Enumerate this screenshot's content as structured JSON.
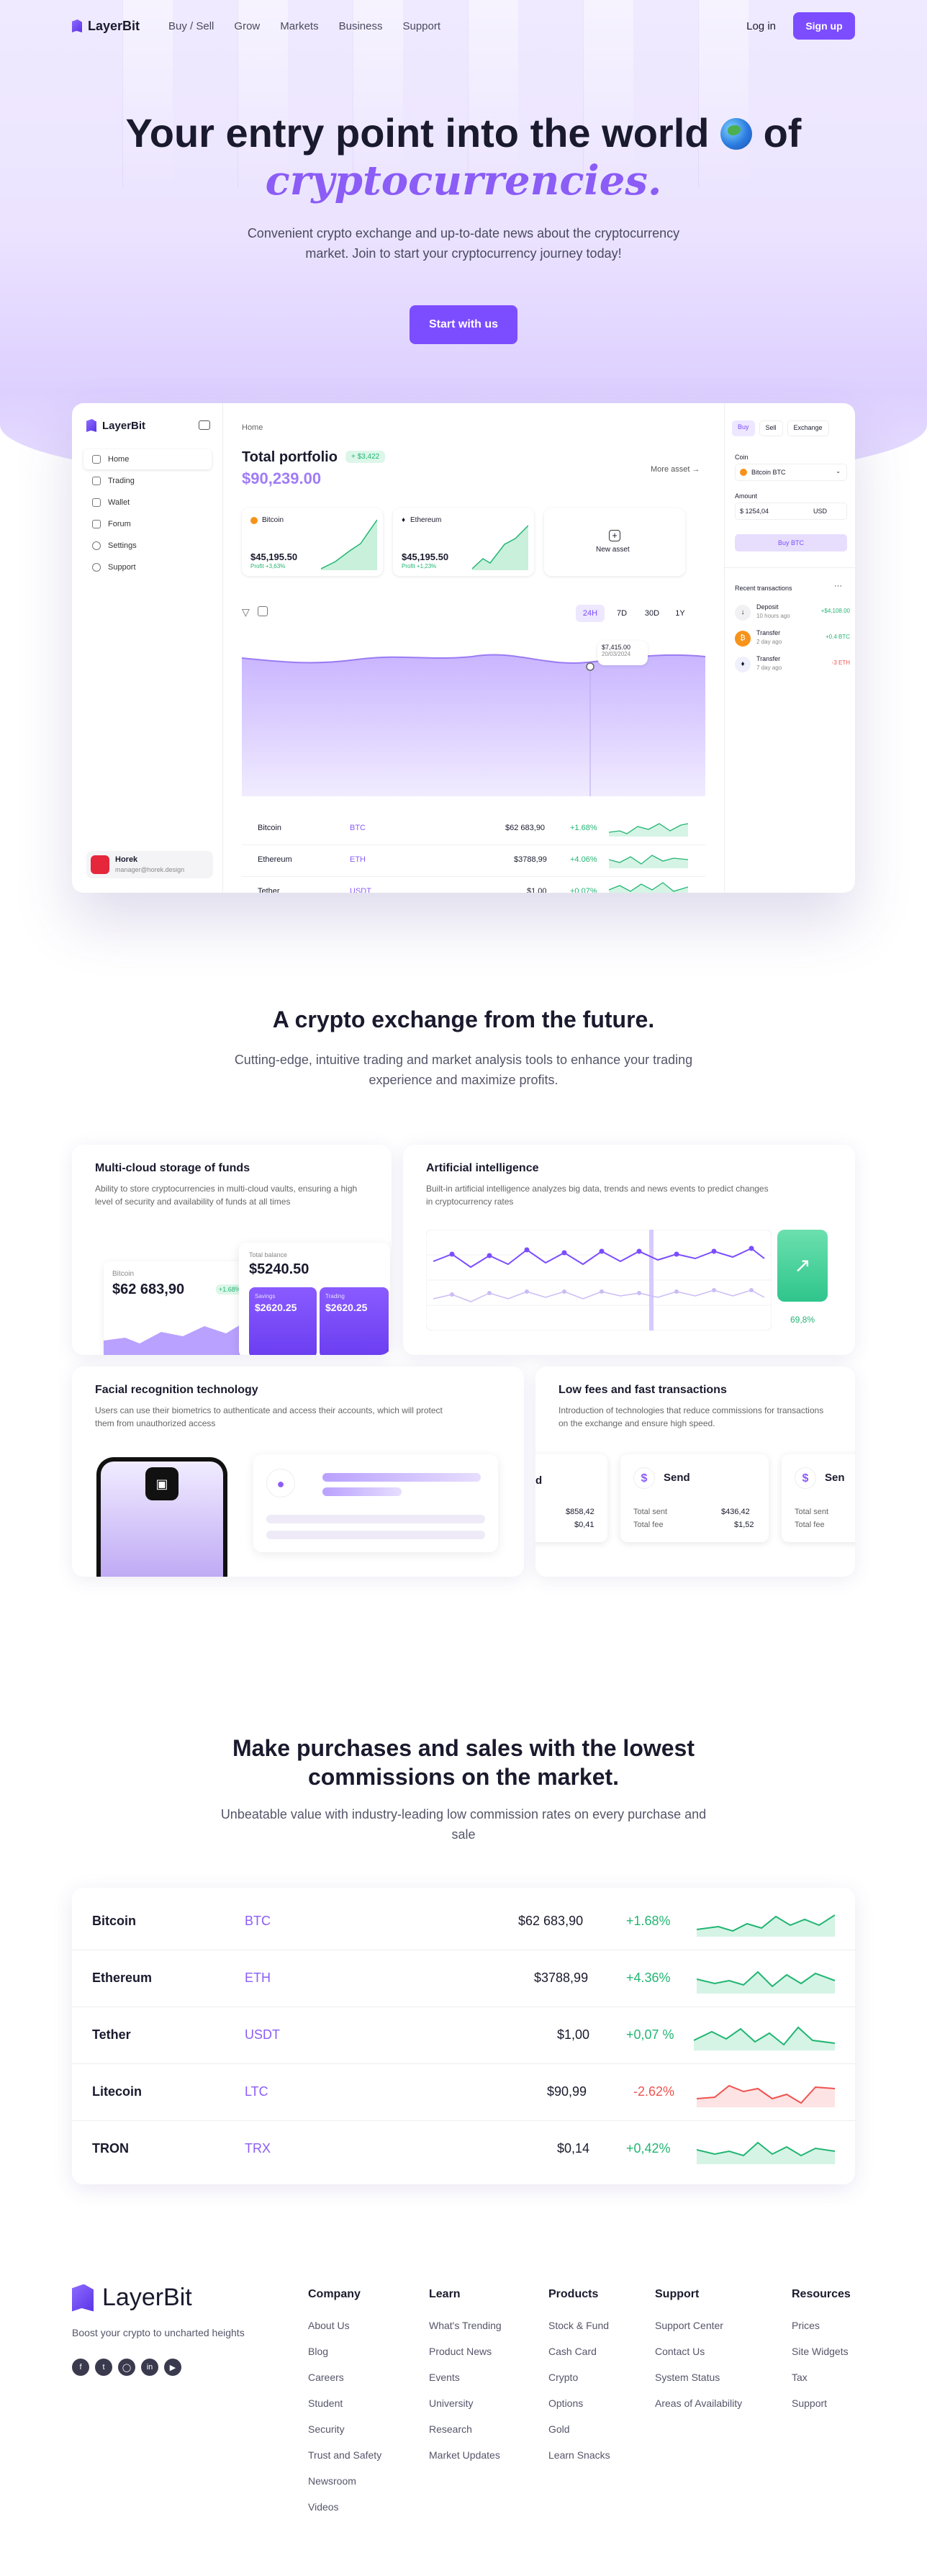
{
  "nav": {
    "brand": "LayerBit",
    "links": [
      "Buy / Sell",
      "Grow",
      "Markets",
      "Business",
      "Support"
    ],
    "login": "Log in",
    "signup": "Sign up"
  },
  "hero": {
    "title_pre": "Your entry point into the world",
    "title_post": "of",
    "title_accent": "cryptocurrencies.",
    "subtitle": "Convenient crypto exchange and up-to-date news about the cryptocurrency market. Join to start your cryptocurrency journey today!",
    "cta": "Start with us"
  },
  "dashboard": {
    "brand": "LayerBit",
    "breadcrumb": "Home",
    "sidebar": [
      "Home",
      "Trading",
      "Wallet",
      "Forum",
      "Settings",
      "Support"
    ],
    "user": {
      "name": "Horek",
      "email": "manager@horek.design"
    },
    "portfolio": {
      "title": "Total portfolio",
      "badge": "+ $3,422",
      "value": "$90,239.00",
      "more": "More asset →"
    },
    "assets": [
      {
        "name": "Bitcoin",
        "value": "$45,195.50",
        "profit": "Profit +3,63%"
      },
      {
        "name": "Ethereum",
        "value": "$45,195.50",
        "profit": "Profit +1,23%"
      }
    ],
    "new_asset": "New asset",
    "ranges": [
      "24H",
      "7D",
      "30D",
      "1Y"
    ],
    "tooltip": {
      "value": "$7,415.00",
      "date": "20/03/2024"
    },
    "rows": [
      {
        "name": "Bitcoin",
        "sym": "BTC",
        "price": "$62 683,90",
        "chg": "+1.68%"
      },
      {
        "name": "Ethereum",
        "sym": "ETH",
        "price": "$3788,99",
        "chg": "+4.06%"
      },
      {
        "name": "Tether",
        "sym": "USDT",
        "price": "$1,00",
        "chg": "+0.07%"
      }
    ],
    "trade": {
      "tabs": [
        "Buy",
        "Sell",
        "Exchange"
      ],
      "coin_label": "Coin",
      "coin": "Bitcoin BTC",
      "amount_label": "Amount",
      "amount": "$ 1254,04",
      "currency": "USD",
      "button": "Buy BTC"
    },
    "recent": {
      "title": "Recent transactions",
      "items": [
        {
          "name": "Deposit",
          "time": "10 hours ago",
          "amount": "+$4,108.00"
        },
        {
          "name": "Transfer",
          "time": "2 day ago",
          "amount": "+0.4 BTC"
        },
        {
          "name": "Transfer",
          "time": "7 day ago",
          "amount": "-3 ETH"
        }
      ]
    }
  },
  "features": {
    "title": "A crypto exchange from the future.",
    "subtitle": "Cutting-edge, intuitive trading and market analysis tools to enhance your trading experience and maximize profits.",
    "cloud": {
      "title": "Multi-cloud storage of funds",
      "text": "Ability to store cryptocurrencies in multi-cloud vaults, ensuring a high level of security and availability of funds at all times",
      "coin_label": "Bitcoin",
      "coin_value": "$62 683,90",
      "coin_chg": "+1.68%",
      "total_label": "Total balance",
      "total": "$5240.50",
      "s1_label": "Savings",
      "s1": "$2620.25",
      "s2_label": "Trading",
      "s2": "$2620.25"
    },
    "ai": {
      "title": "Artificial intelligence",
      "text": "Built-in artificial intelligence analyzes big data, trends and news events to predict changes in cryptocurrency rates",
      "pct": "69,8%"
    },
    "face": {
      "title": "Facial recognition technology",
      "text": "Users can use their biometrics to authenticate and access their accounts, which will protect them from unauthorized access"
    },
    "fees": {
      "title": "Low fees and fast transactions",
      "text": "Introduction of technologies that reduce commissions for transactions on the exchange and ensure high speed.",
      "send": "Send",
      "total_sent_label": "Total sent",
      "total_fee_label": "Total fee",
      "c1_sent": "$858,42",
      "c1_fee": "$0,41",
      "c1_title": "d",
      "c2_sent": "$436,42",
      "c2_fee": "$1,52",
      "c3_title": "Sen"
    }
  },
  "market": {
    "title": "Make purchases and sales with the lowest commissions on the market.",
    "subtitle": "Unbeatable value with industry-leading low commission rates on every purchase and sale",
    "rows": [
      {
        "name": "Bitcoin",
        "sym": "BTC",
        "price": "$62 683,90",
        "chg": "+1.68%",
        "up": true
      },
      {
        "name": "Ethereum",
        "sym": "ETH",
        "price": "$3788,99",
        "chg": "+4.36%",
        "up": true
      },
      {
        "name": "Tether",
        "sym": "USDT",
        "price": "$1,00",
        "chg": "+0,07 %",
        "up": true
      },
      {
        "name": "Litecoin",
        "sym": "LTC",
        "price": "$90,99",
        "chg": "-2.62%",
        "up": false
      },
      {
        "name": "TRON",
        "sym": "TRX",
        "price": "$0,14",
        "chg": "+0,42%",
        "up": true
      }
    ]
  },
  "footer": {
    "brand": "LayerBit",
    "tagline": "Boost your crypto to uncharted heights",
    "social": [
      "facebook-icon",
      "twitter-icon",
      "instagram-icon",
      "linkedin-icon",
      "youtube-icon"
    ],
    "cols": [
      {
        "title": "Company",
        "items": [
          "About Us",
          "Blog",
          "Careers",
          "Student",
          "Security",
          "Trust and Safety",
          "Newsroom",
          "Videos"
        ]
      },
      {
        "title": "Learn",
        "items": [
          "What's Trending",
          "Product News",
          "Events",
          "University",
          "Research",
          "Market Updates"
        ]
      },
      {
        "title": "Products",
        "items": [
          "Stock & Fund",
          "Cash Card",
          "Crypto",
          "Options",
          "Gold",
          "Learn Snacks"
        ]
      },
      {
        "title": "Support",
        "items": [
          "Support Center",
          "Contact Us",
          "System Status",
          "Areas of Availability"
        ]
      },
      {
        "title": "Resources",
        "items": [
          "Prices",
          "Site Widgets",
          "Tax",
          "Support"
        ]
      }
    ]
  },
  "colors": {
    "accent": "#7c4dff",
    "up": "#22b573",
    "down": "#ef5350"
  }
}
